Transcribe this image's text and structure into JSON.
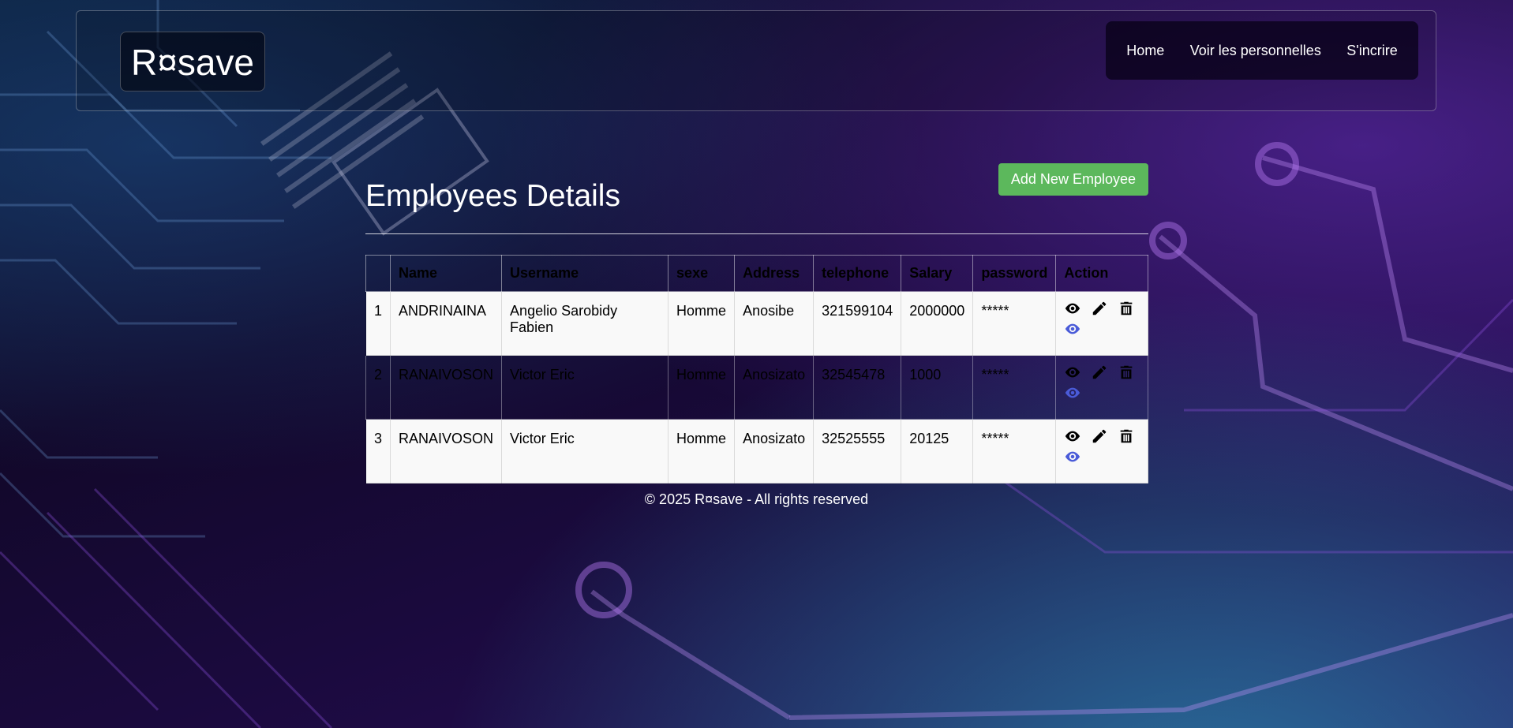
{
  "brand": "R¤save",
  "nav": {
    "home": "Home",
    "personnel": "Voir les personnelles",
    "register": "S'incrire"
  },
  "page": {
    "title": "Employees Details",
    "add_button": "Add New Employee"
  },
  "table": {
    "headers": [
      "",
      "Name",
      "Username",
      "sexe",
      "Address",
      "telephone",
      "Salary",
      "password",
      "Action"
    ],
    "rows": [
      {
        "id": "1",
        "name": "ANDRINAINA",
        "username": "Angelio Sarobidy Fabien",
        "sexe": "Homme",
        "address": "Anosibe",
        "telephone": "321599104",
        "salary": "2000000",
        "password": "*****"
      },
      {
        "id": "2",
        "name": "RANAIVOSON",
        "username": "Victor Eric",
        "sexe": "Homme",
        "address": "Anosizato",
        "telephone": "32545478",
        "salary": "1000",
        "password": "*****"
      },
      {
        "id": "3",
        "name": "RANAIVOSON",
        "username": "Victor Eric",
        "sexe": "Homme",
        "address": "Anosizato",
        "telephone": "32525555",
        "salary": "20125",
        "password": "*****"
      }
    ]
  },
  "icons": {
    "view": "eye-icon",
    "edit": "pencil-icon",
    "delete": "trash-icon",
    "view_alt": "eye-icon"
  },
  "colors": {
    "add_button": "#5cb85c",
    "view_alt_icon": "#4a5bd8"
  },
  "footer": "© 2025 R¤save - All rights reserved"
}
